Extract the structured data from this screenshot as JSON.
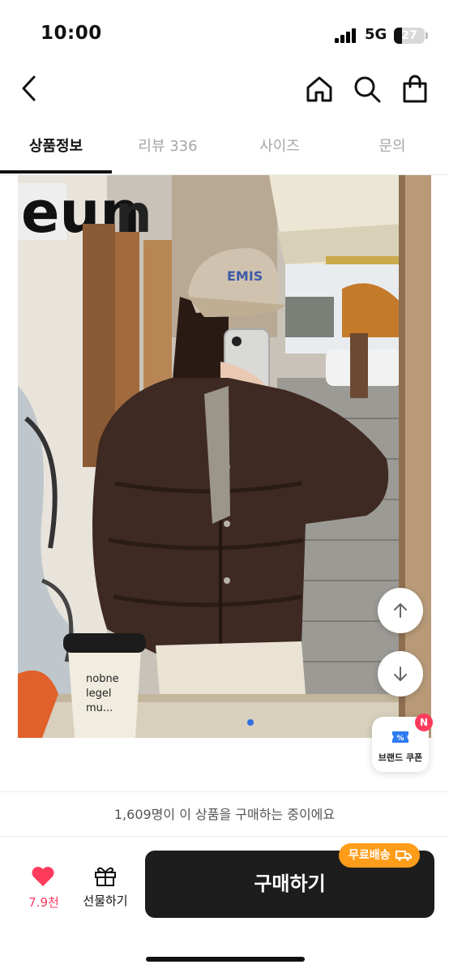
{
  "status_bar": {
    "time": "10:00",
    "network": "5G",
    "battery": "27",
    "battery_level": 0.27
  },
  "nav": {
    "back_icon": "chevron-left-icon",
    "home_icon": "home-icon",
    "search_icon": "search-icon",
    "cart_icon": "shopping-bag-icon"
  },
  "tabs": [
    {
      "label": "상품정보",
      "active": true
    },
    {
      "label": "리뷰 336",
      "active": false
    },
    {
      "label": "사이즈",
      "active": false
    },
    {
      "label": "문의",
      "active": false
    }
  ],
  "product_image": {
    "cap_text": "EMIS",
    "cup_text": "nobne\nlegel\nmu..."
  },
  "scroll_buttons": {
    "up_icon": "arrow-up-icon",
    "down_icon": "arrow-down-icon"
  },
  "coupon": {
    "label": "브랜드 쿠폰",
    "badge": "N",
    "icon": "coupon-icon"
  },
  "notice": "1,609명이 이 상품을 구매하는 중이에요",
  "bottom_bar": {
    "like_count": "7.9천",
    "gift_label": "선물하기",
    "buy_label": "구매하기",
    "free_shipping": "무료배송",
    "accent": "#ff3b5c",
    "shipping_color": "#ff9d1a"
  }
}
